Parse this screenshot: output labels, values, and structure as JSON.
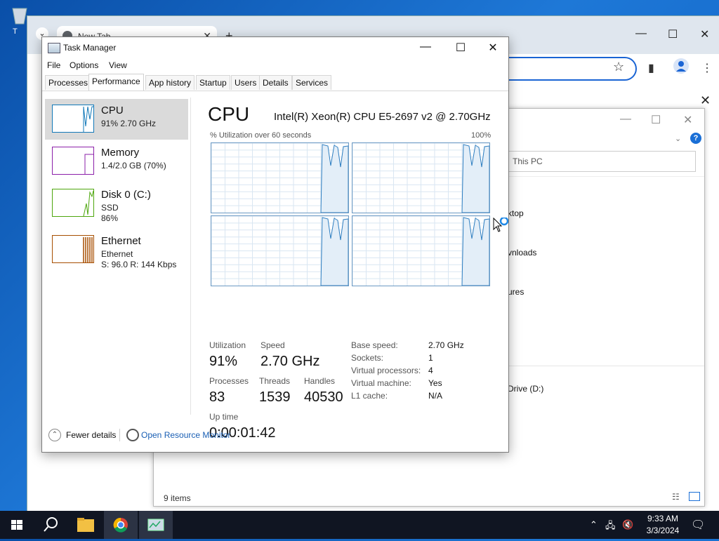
{
  "desktop": {
    "icon_label": "T"
  },
  "chrome": {
    "tab_title": "New Tab",
    "close_glyph": "✕",
    "new_tab_glyph": "+",
    "minimize_glyph": "—",
    "maximize_glyph": "☐",
    "bookmark_close_glyph": "✕"
  },
  "explorer": {
    "search_placeholder": "This PC",
    "items": [
      "ktop",
      "vnloads",
      "ures",
      "Drive (D:)"
    ],
    "status": "9 items"
  },
  "taskmanager": {
    "title": "Task Manager",
    "menu": [
      "File",
      "Options",
      "View"
    ],
    "tabs": [
      "Processes",
      "Performance",
      "App history",
      "Startup",
      "Users",
      "Details",
      "Services"
    ],
    "active_tab": "Performance",
    "resources": [
      {
        "name": "CPU",
        "lines": [
          "91%  2.70 GHz"
        ],
        "color": "#1178b8"
      },
      {
        "name": "Memory",
        "lines": [
          "1.4/2.0 GB (70%)"
        ],
        "color": "#8b1fa9"
      },
      {
        "name": "Disk 0 (C:)",
        "lines": [
          "SSD",
          "86%"
        ],
        "color": "#4da60c"
      },
      {
        "name": "Ethernet",
        "lines": [
          "Ethernet",
          "S: 96.0  R: 144 Kbps"
        ],
        "color": "#a74f01"
      }
    ],
    "detail": {
      "heading": "CPU",
      "model": "Intel(R) Xeon(R) CPU E5-2697 v2 @ 2.70GHz",
      "graph_caption": "% Utilization over 60 seconds",
      "graph_max": "100%",
      "stats": {
        "utilization_label": "Utilization",
        "utilization": "91%",
        "speed_label": "Speed",
        "speed": "2.70 GHz",
        "processes_label": "Processes",
        "processes": "83",
        "threads_label": "Threads",
        "threads": "1539",
        "handles_label": "Handles",
        "handles": "40530",
        "uptime_label": "Up time",
        "uptime": "0:00:01:42"
      },
      "specs": [
        {
          "k": "Base speed:",
          "v": "2.70 GHz"
        },
        {
          "k": "Sockets:",
          "v": "1"
        },
        {
          "k": "Virtual processors:",
          "v": "4"
        },
        {
          "k": "Virtual machine:",
          "v": "Yes"
        },
        {
          "k": "L1 cache:",
          "v": "N/A"
        }
      ]
    },
    "footer": {
      "fewer_details": "Fewer details",
      "open_resource_monitor": "Open Resource Monitor"
    }
  },
  "taskbar": {
    "time": "9:33 AM",
    "date": "3/3/2024"
  }
}
